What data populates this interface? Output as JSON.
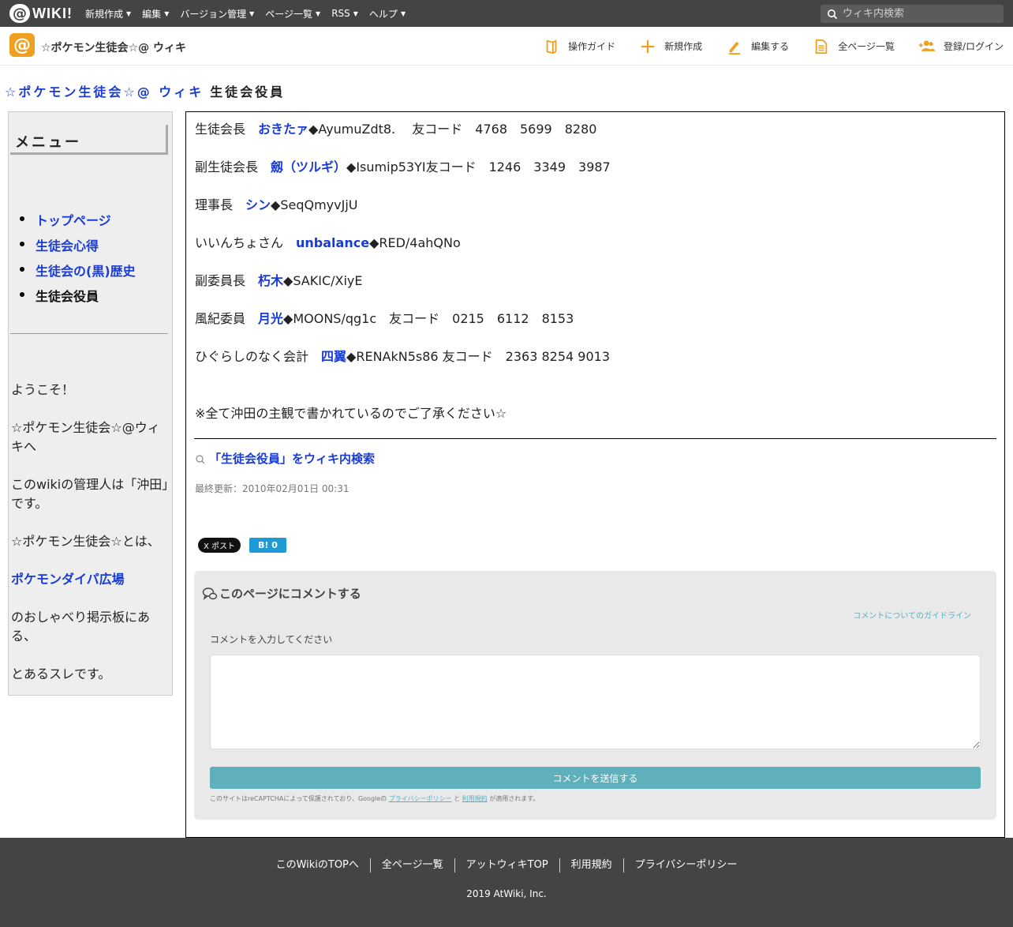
{
  "topbar": {
    "logo_at": "@",
    "logo_text": "WIKI!",
    "nav": [
      "新規作成",
      "編集",
      "バージョン管理",
      "ページ一覧",
      "RSS",
      "ヘルプ"
    ],
    "search_placeholder": "ウィキ内検索"
  },
  "header": {
    "site_name": "☆ポケモン生徒会☆@ ウィキ",
    "actions": [
      "操作ガイド",
      "新規作成",
      "編集する",
      "全ページ一覧",
      "登録/ログイン"
    ]
  },
  "page": {
    "wiki_title": "☆ポケモン生徒会☆@ ウィキ",
    "page_name": "生徒会役員"
  },
  "menu": {
    "title": "メニュー",
    "items": [
      {
        "label": "トップページ",
        "current": false
      },
      {
        "label": "生徒会心得",
        "current": false
      },
      {
        "label": "生徒会の(黒)歴史",
        "current": false
      },
      {
        "label": "生徒会役員",
        "current": true
      }
    ],
    "welcome": [
      "ようこそ！",
      "☆ポケモン生徒会☆@ウィキへ",
      "このwikiの管理人は「沖田」です。",
      "☆ポケモン生徒会☆とは、"
    ],
    "board_link": "ポケモンダイパ広場",
    "welcome2": [
      "のおしゃべり掲示板にある、",
      "とあるスレです。"
    ]
  },
  "officers": [
    {
      "role": "生徒会長　",
      "name": "おきたァ",
      "after": "◆AyumuZdt8.　 友コード　4768　5699　8280"
    },
    {
      "role": "副生徒会長　",
      "name": "劔（ツルギ）",
      "after": "◆Isumip53YI友コード　1246　3349　3987"
    },
    {
      "role": "理事長　",
      "name": "シン",
      "after": "◆SeqQmyvJjU"
    },
    {
      "role": "いいんちょさん　",
      "name": "unbalance",
      "after": "◆RED/4ahQNo"
    },
    {
      "role": "副委員長　",
      "name": "朽木",
      "after": "◆SAKIC/XiyE"
    },
    {
      "role": "風紀委員　",
      "name": "月光",
      "after": "◆MOONS/qg1c　友コード　0215　6112　8153"
    },
    {
      "role": "ひぐらしのなく会計　",
      "name": "四翼",
      "after": "◆RENAkN5s86 友コード　2363 8254 9013"
    }
  ],
  "note": "※全て沖田の主観で書かれているのでご了承ください☆",
  "wiki_search_link": "「生徒会役員」をウィキ内検索",
  "last_updated": "最終更新：2010年02月01日 00:31",
  "social": {
    "tweet": "X ポスト",
    "hatena": "B! 0"
  },
  "comment": {
    "title": "このページにコメントする",
    "info_link": "コメントについてのガイドライン",
    "label": "コメントを入力してください",
    "submit": "コメントを送信する",
    "recaptcha_prefix": "このサイトはreCAPTCHAによって保護されており、Googleの",
    "privacy": "プライバシーポリシー",
    "and": "と",
    "terms": "利用規約",
    "suffix": "が適用されます。"
  },
  "footer": {
    "links": [
      "このWikiのTOPへ",
      "全ページ一覧",
      "アットウィキTOP",
      "利用規約",
      "プライバシーポリシー"
    ],
    "copyright": "2019 AtWiki, Inc."
  },
  "colors": {
    "topbar": "#444444",
    "link": "#1a3cd6",
    "accent": "#f0a020",
    "submit": "#5fb0bb"
  }
}
